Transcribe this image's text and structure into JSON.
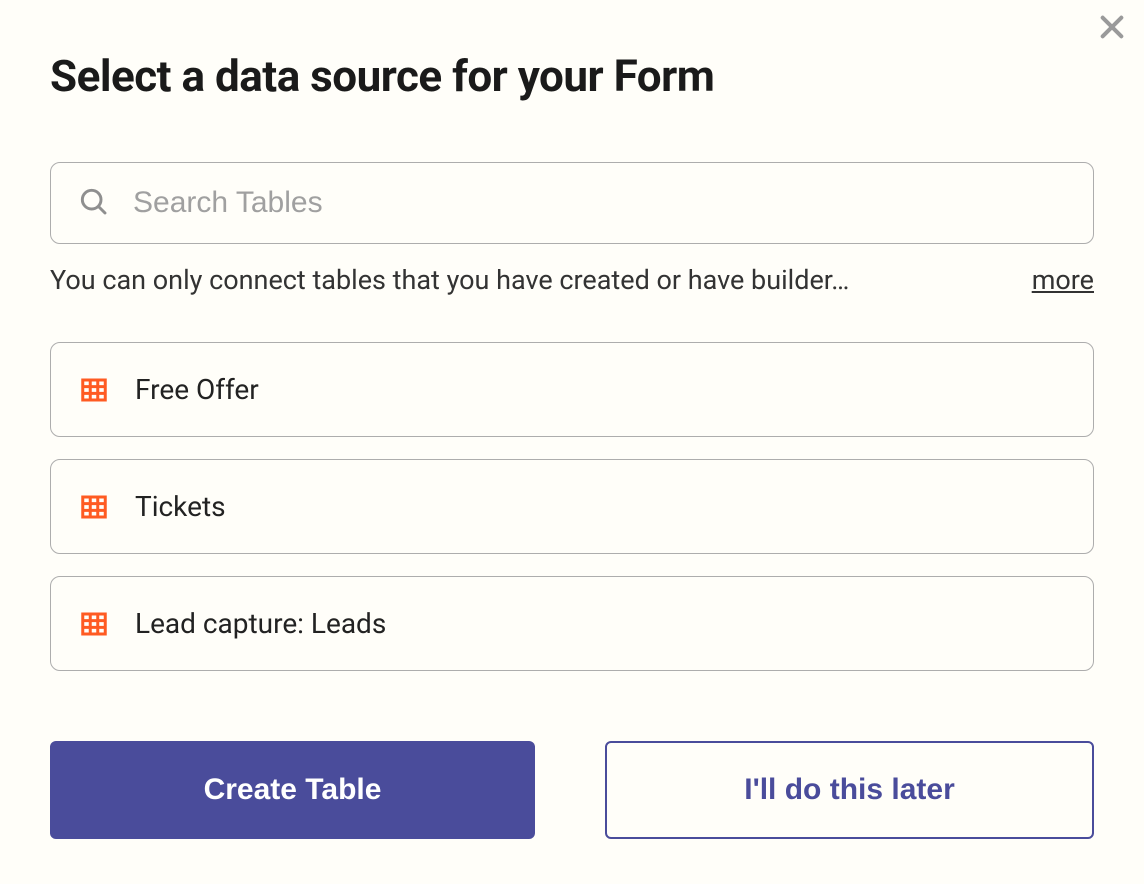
{
  "title": "Select a data source for your Form",
  "search": {
    "placeholder": "Search Tables"
  },
  "hint": "You can only connect tables that you have created or have builder…",
  "more_label": "more",
  "tables": [
    {
      "label": "Free Offer"
    },
    {
      "label": "Tickets"
    },
    {
      "label": "Lead capture: Leads"
    }
  ],
  "buttons": {
    "primary": "Create Table",
    "secondary": "I'll do this later"
  },
  "colors": {
    "accent": "#4a4c9b",
    "icon_table": "#ff5b22"
  }
}
